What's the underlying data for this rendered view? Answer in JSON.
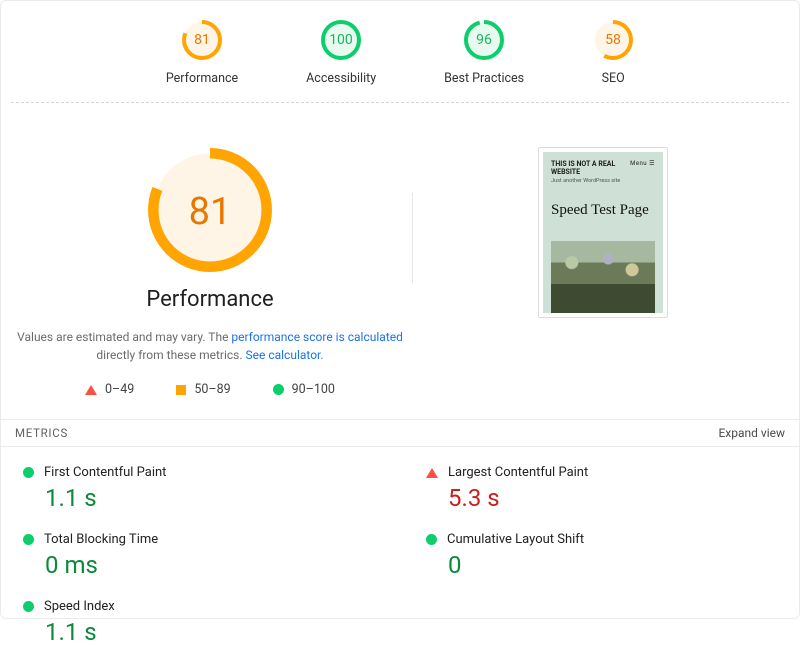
{
  "categories": [
    {
      "id": "performance",
      "label": "Performance",
      "score": 81,
      "level": "avg"
    },
    {
      "id": "accessibility",
      "label": "Accessibility",
      "score": 100,
      "level": "good"
    },
    {
      "id": "best-practices",
      "label": "Best Practices",
      "score": 96,
      "level": "good"
    },
    {
      "id": "seo",
      "label": "SEO",
      "score": 58,
      "level": "avg"
    }
  ],
  "performance": {
    "score": 81,
    "title": "Performance",
    "desc_prefix": "Values are estimated and may vary. The ",
    "link1": "performance score is calculated",
    "desc_mid": " directly from these metrics. ",
    "link2": "See calculator"
  },
  "legend": {
    "fail": "0–49",
    "avg": "50–89",
    "pass": "90–100"
  },
  "thumbnail": {
    "menu": "Menu ☰",
    "tag": "THIS IS NOT A REAL WEBSITE",
    "sub": "Just another WordPress site",
    "heading": "Speed Test Page"
  },
  "metrics": {
    "section_title": "METRICS",
    "expand": "Expand view",
    "items": [
      {
        "label": "First Contentful Paint",
        "value": "1.1 s",
        "status": "pass"
      },
      {
        "label": "Largest Contentful Paint",
        "value": "5.3 s",
        "status": "fail"
      },
      {
        "label": "Total Blocking Time",
        "value": "0 ms",
        "status": "pass"
      },
      {
        "label": "Cumulative Layout Shift",
        "value": "0",
        "status": "pass"
      },
      {
        "label": "Speed Index",
        "value": "1.1 s",
        "status": "pass"
      }
    ]
  },
  "colors": {
    "avg": "#ffa400",
    "good": "#0cce6b",
    "fail": "#ff4e42",
    "avg_text": "#e67700",
    "good_text": "#18b663"
  }
}
